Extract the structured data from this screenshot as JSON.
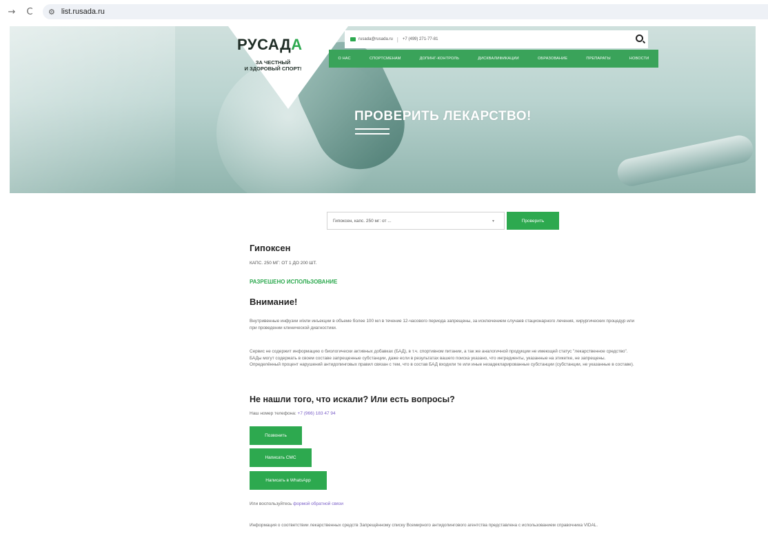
{
  "browser": {
    "back": "→",
    "reload": "C",
    "url": "list.rusada.ru"
  },
  "header": {
    "logo": "РУСАД",
    "logo_mark": "А",
    "tagline_1": "ЗА ЧЕСТНЫЙ",
    "tagline_2": "И ЗДОРОВЫЙ СПОРТ!",
    "email": "rusada@rusada.ru",
    "phone": "+7 (499) 271-77-81",
    "nav": [
      "О НАС",
      "СПОРТСМЕНАМ",
      "ДОПИНГ-КОНТРОЛЬ",
      "ДИСКВАЛИФИКАЦИИ",
      "ОБРАЗОВАНИЕ",
      "ПРЕПАРАТЫ",
      "НОВОСТИ"
    ]
  },
  "hero": {
    "title": "ПРОВЕРИТЬ ЛЕКАРСТВО!"
  },
  "search": {
    "selected": "Гипоксен, капс. 250 мг: от ...",
    "button": "Проверить"
  },
  "result": {
    "name": "Гипоксен",
    "dose": "КАПС. 250 МГ: ОТ 1 ДО 200 ШТ.",
    "status": "РАЗРЕШЕНО ИСПОЛЬЗОВАНИЕ",
    "status_color": "#2da94f"
  },
  "warning": {
    "title": "Внимание!",
    "p1": "Внутривенные инфузии и/или инъекции в объеме более 100 мл в течение 12-часового периода запрещены, за исключением случаев стационарного лечения, хирургических процедур или при проведении клинической диагностики.",
    "p2": "Сервис не содержит информацию о биологически активных добавках (БАД), в т.ч. спортивном питании, а так же аналогичной продукции не имеющей статус \"лекарственное средство\". БАДы могут содержать в своем составе запрещенные субстанции, даже если в результатах вашего поиска указано, что ингредиенты, указанные на этикетке, не запрещены. Определённый процент нарушений антидопинговых правил связан с тем, что в состав БАД входили те или иные незадекларированные субстанции (субстанции, не указанные в составе)."
  },
  "contact": {
    "title": "Не нашли того, что искали? Или есть вопросы?",
    "phone_label": "Наш номер телефона: ",
    "phone": "+7 (966) 183 47 94",
    "btn_call": "Позвонить",
    "btn_sms": "Написать СМС",
    "btn_whatsapp": "Написать в WhatsApp",
    "feedback_prefix": "Или воспользуйтесь ",
    "feedback_link": "формой обратной связи",
    "info": "Информация о соответствии лекарственных средств Запрещённому списку Всемирного антидопингового агентства представлена с использованием справочника VIDAL."
  },
  "colors": {
    "accent": "#2da94f",
    "link": "#7a5fc7"
  }
}
